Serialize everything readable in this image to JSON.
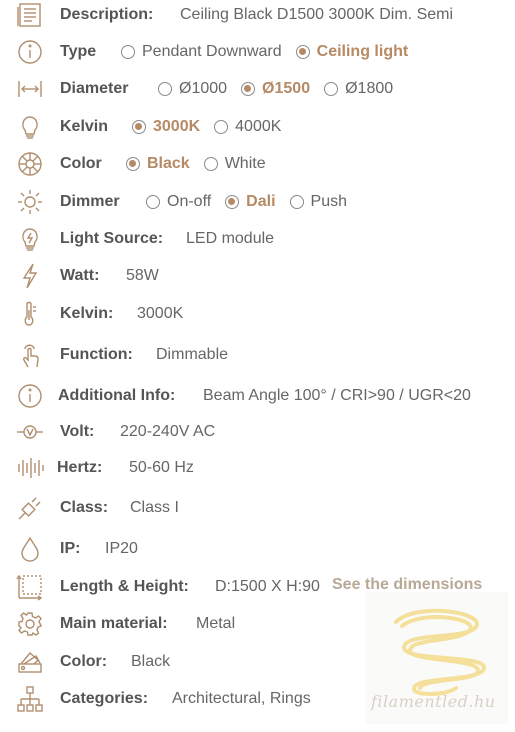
{
  "rows": {
    "description": {
      "label": "Description:",
      "value": "Ceiling Black D1500 3000K Dim. Semi",
      "icon": "document-icon"
    },
    "type": {
      "label": "Type",
      "options": [
        {
          "label": "Pendant Downward",
          "selected": false
        },
        {
          "label": "Ceiling light",
          "selected": true
        }
      ],
      "icon": "info-icon"
    },
    "diameter": {
      "label": "Diameter",
      "options": [
        {
          "label": "Ø1000",
          "selected": false
        },
        {
          "label": "Ø1500",
          "selected": true
        },
        {
          "label": "Ø1800",
          "selected": false
        }
      ],
      "icon": "width-arrows-icon"
    },
    "kelvin_opt": {
      "label": "Kelvin",
      "options": [
        {
          "label": "3000K",
          "selected": true
        },
        {
          "label": "4000K",
          "selected": false
        }
      ],
      "icon": "bulb-icon"
    },
    "color_opt": {
      "label": "Color",
      "options": [
        {
          "label": "Black",
          "selected": true
        },
        {
          "label": "White",
          "selected": false
        }
      ],
      "icon": "color-wheel-icon"
    },
    "dimmer": {
      "label": "Dimmer",
      "options": [
        {
          "label": "On-off",
          "selected": false
        },
        {
          "label": "Dali",
          "selected": true
        },
        {
          "label": "Push",
          "selected": false
        }
      ],
      "icon": "sun-icon"
    },
    "light_source": {
      "label": "Light Source:",
      "value": "LED module",
      "icon": "bulb-bolt-icon"
    },
    "watt": {
      "label": "Watt:",
      "value": "58W",
      "icon": "lightning-icon"
    },
    "kelvin": {
      "label": "Kelvin:",
      "value": "3000K",
      "icon": "thermometer-icon"
    },
    "function": {
      "label": "Function:",
      "value": "Dimmable",
      "icon": "hand-touch-icon"
    },
    "additional": {
      "label": "Additional Info:",
      "value": "Beam Angle 100° / CRI>90 / UGR<20",
      "icon": "info-circle-icon"
    },
    "volt": {
      "label": "Volt:",
      "value": "220-240V AC",
      "icon": "voltmeter-icon"
    },
    "hertz": {
      "label": "Hertz:",
      "value": "50-60 Hz",
      "icon": "frequency-icon"
    },
    "class": {
      "label": "Class:",
      "value": "Class I",
      "icon": "plug-icon"
    },
    "ip": {
      "label": "IP:",
      "value": "IP20",
      "icon": "water-drop-icon"
    },
    "length": {
      "label": "Length & Height:",
      "value": "D:1500 X H:90",
      "link": "See the dimensions",
      "icon": "dimensions-icon"
    },
    "material": {
      "label": "Main material:",
      "value": "Metal",
      "icon": "gear-icon"
    },
    "color": {
      "label": "Color:",
      "value": "Black",
      "icon": "color-swatch-icon"
    },
    "categories": {
      "label": "Categories:",
      "value": "Architectural, Rings",
      "icon": "sitemap-icon"
    }
  },
  "watermark": {
    "text": "filamentled.hu"
  },
  "colors": {
    "accent": "#b58a64",
    "icon": "#b08f6f",
    "label": "#555555",
    "value": "#666666"
  }
}
